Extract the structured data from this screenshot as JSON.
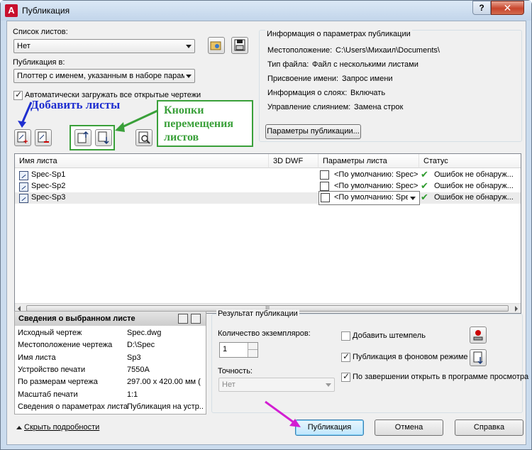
{
  "window": {
    "title": "Публикация",
    "help": "?",
    "close": "✕"
  },
  "sheet_list": {
    "label": "Список листов:",
    "value": "Нет"
  },
  "publish_to": {
    "label": "Публикация в:",
    "value": "Плоттер с именем, указанным в наборе парамет"
  },
  "auto_load": {
    "label": "Автоматически загружать все открытые чертежи",
    "checked": true
  },
  "info": {
    "title": "Информация о параметрах публикации",
    "rows": [
      {
        "k": "Местоположение:",
        "v": "C:\\Users\\Михаил\\Documents\\"
      },
      {
        "k": "Тип файла:",
        "v": "Файл с несколькими листами"
      },
      {
        "k": "Присвоение имени:",
        "v": "Запрос имени"
      },
      {
        "k": "Информация о слоях:",
        "v": "Включать"
      },
      {
        "k": "Управление слиянием:",
        "v": "Замена строк"
      }
    ],
    "button": "Параметры публикации..."
  },
  "annotations": {
    "add_sheets": "Добавить листы",
    "move_buttons": "Кнопки перемещения листов"
  },
  "grid": {
    "headers": [
      "Имя листа",
      "3D DWF",
      "Параметры листа",
      "Статус"
    ],
    "rows": [
      {
        "name": "Spec-Sp1",
        "params": "<По умолчанию: Spec>",
        "status": "Ошибок не обнаруж..."
      },
      {
        "name": "Spec-Sp2",
        "params": "<По умолчанию: Spec>",
        "status": "Ошибок не обнаруж..."
      },
      {
        "name": "Spec-Sp3",
        "params": "<По умолчанию: Spec",
        "status": "Ошибок не обнаруж..."
      }
    ],
    "scroll_grip": "III"
  },
  "details": {
    "title": "Сведения о выбранном листе",
    "rows": [
      {
        "k": "Исходный чертеж",
        "v": "Spec.dwg"
      },
      {
        "k": "Местоположение чертежа",
        "v": "D:\\Spec"
      },
      {
        "k": "Имя листа",
        "v": "Sp3"
      },
      {
        "k": "Устройство печати",
        "v": "7550A"
      },
      {
        "k": "По размерам чертежа",
        "v": "297.00 x 420.00 мм ("
      },
      {
        "k": "Масштаб печати",
        "v": "1:1"
      },
      {
        "k": "Сведения о параметрах листа",
        "v": "Публикация на устр..."
      }
    ]
  },
  "result": {
    "title": "Результат публикации",
    "copies_label": "Количество экземпляров:",
    "copies_value": "1",
    "precision_label": "Точность:",
    "precision_value": "Нет",
    "stamp": {
      "label": "Добавить штемпель",
      "checked": false
    },
    "background": {
      "label": "Публикация в фоновом режиме",
      "checked": true
    },
    "open_viewer": {
      "label": "По завершении открыть в программе просмотра",
      "checked": true
    }
  },
  "footer": {
    "hide_details": "Скрыть подробности",
    "publish": "Публикация",
    "cancel": "Отмена",
    "help": "Справка"
  },
  "colors": {
    "annotation_blue": "#1f2fd0",
    "annotation_green": "#3aa03a",
    "arrow_magenta": "#d21ed2"
  }
}
